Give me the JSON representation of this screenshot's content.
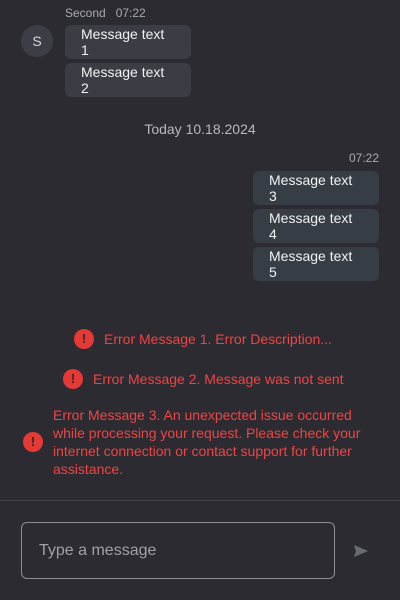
{
  "incoming": {
    "sender": "Second",
    "time": "07:22",
    "avatar_initial": "S",
    "messages": [
      "Message text 1",
      "Message text 2"
    ]
  },
  "day_separator": "Today 10.18.2024",
  "outgoing": {
    "time": "07:22",
    "messages": [
      "Message text 3",
      "Message text 4",
      "Message text 5"
    ]
  },
  "errors": [
    "Error Message 1. Error Description...",
    "Error Message 2. Message was not sent",
    "Error Message 3. An unexpected issue occurred while processing your request. Please check your internet connection or contact support for further assistance."
  ],
  "composer": {
    "placeholder": "Type a message",
    "value": ""
  },
  "icons": {
    "error": "exclamation-circle-icon",
    "send": "send-arrow-icon"
  },
  "colors": {
    "background": "#2b2b31",
    "bubble_in": "#3b3c44",
    "bubble_out": "#363d44",
    "error": "#f04444"
  }
}
